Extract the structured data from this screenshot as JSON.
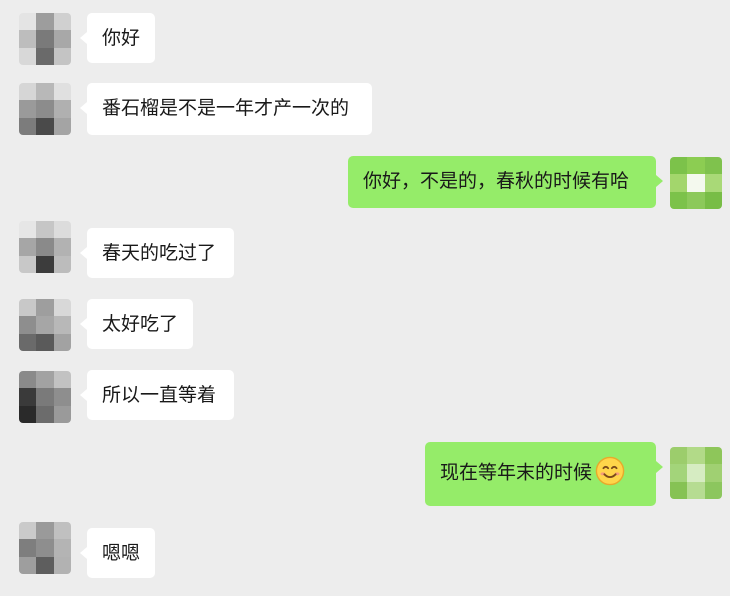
{
  "messages": [
    {
      "side": "in",
      "text": "你好"
    },
    {
      "side": "in",
      "text": "番石榴是不是一年才产一次的"
    },
    {
      "side": "out",
      "text": "你好，不是的，春秋的时候有哈"
    },
    {
      "side": "in",
      "text": "春天的吃过了"
    },
    {
      "side": "in",
      "text": "太好吃了"
    },
    {
      "side": "in",
      "text": "所以一直等着"
    },
    {
      "side": "out",
      "text": "现在等年末的时候",
      "emoji": "smiling-face-emoji"
    },
    {
      "side": "in",
      "text": "嗯嗯"
    }
  ],
  "colors": {
    "background": "#ededed",
    "incoming_bubble": "#ffffff",
    "outgoing_bubble": "#95ec69",
    "text": "#191919"
  }
}
